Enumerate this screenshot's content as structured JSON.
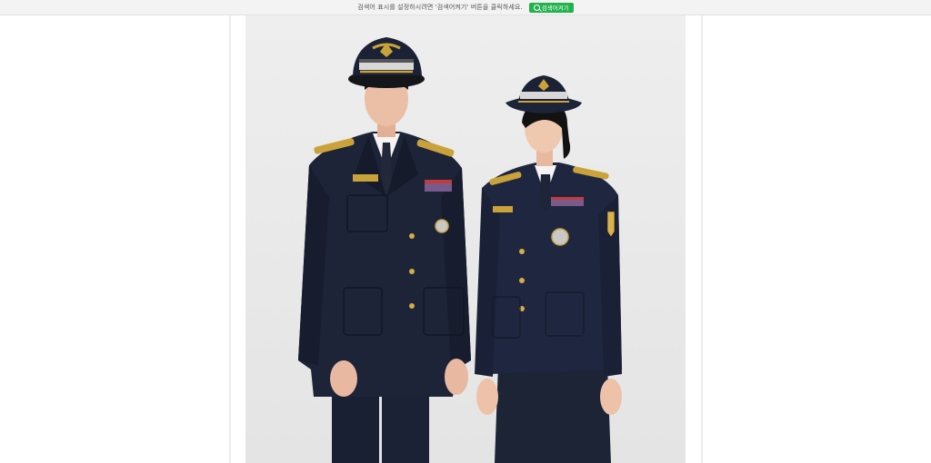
{
  "notice_bar": {
    "message": "검색어 표시를 설정하시려면 '검색어켜기' 버튼을 클릭하세요.",
    "button_label": "검색어켜기",
    "button_color": "#21b24b",
    "button_icon": "search-icon"
  },
  "photo": {
    "subject": "police-uniform-photo",
    "colors": {
      "uniform": "#1c2338",
      "gold": "#c9a33a",
      "background": "#eaeaea",
      "shirt": "#f4f4f4"
    }
  }
}
